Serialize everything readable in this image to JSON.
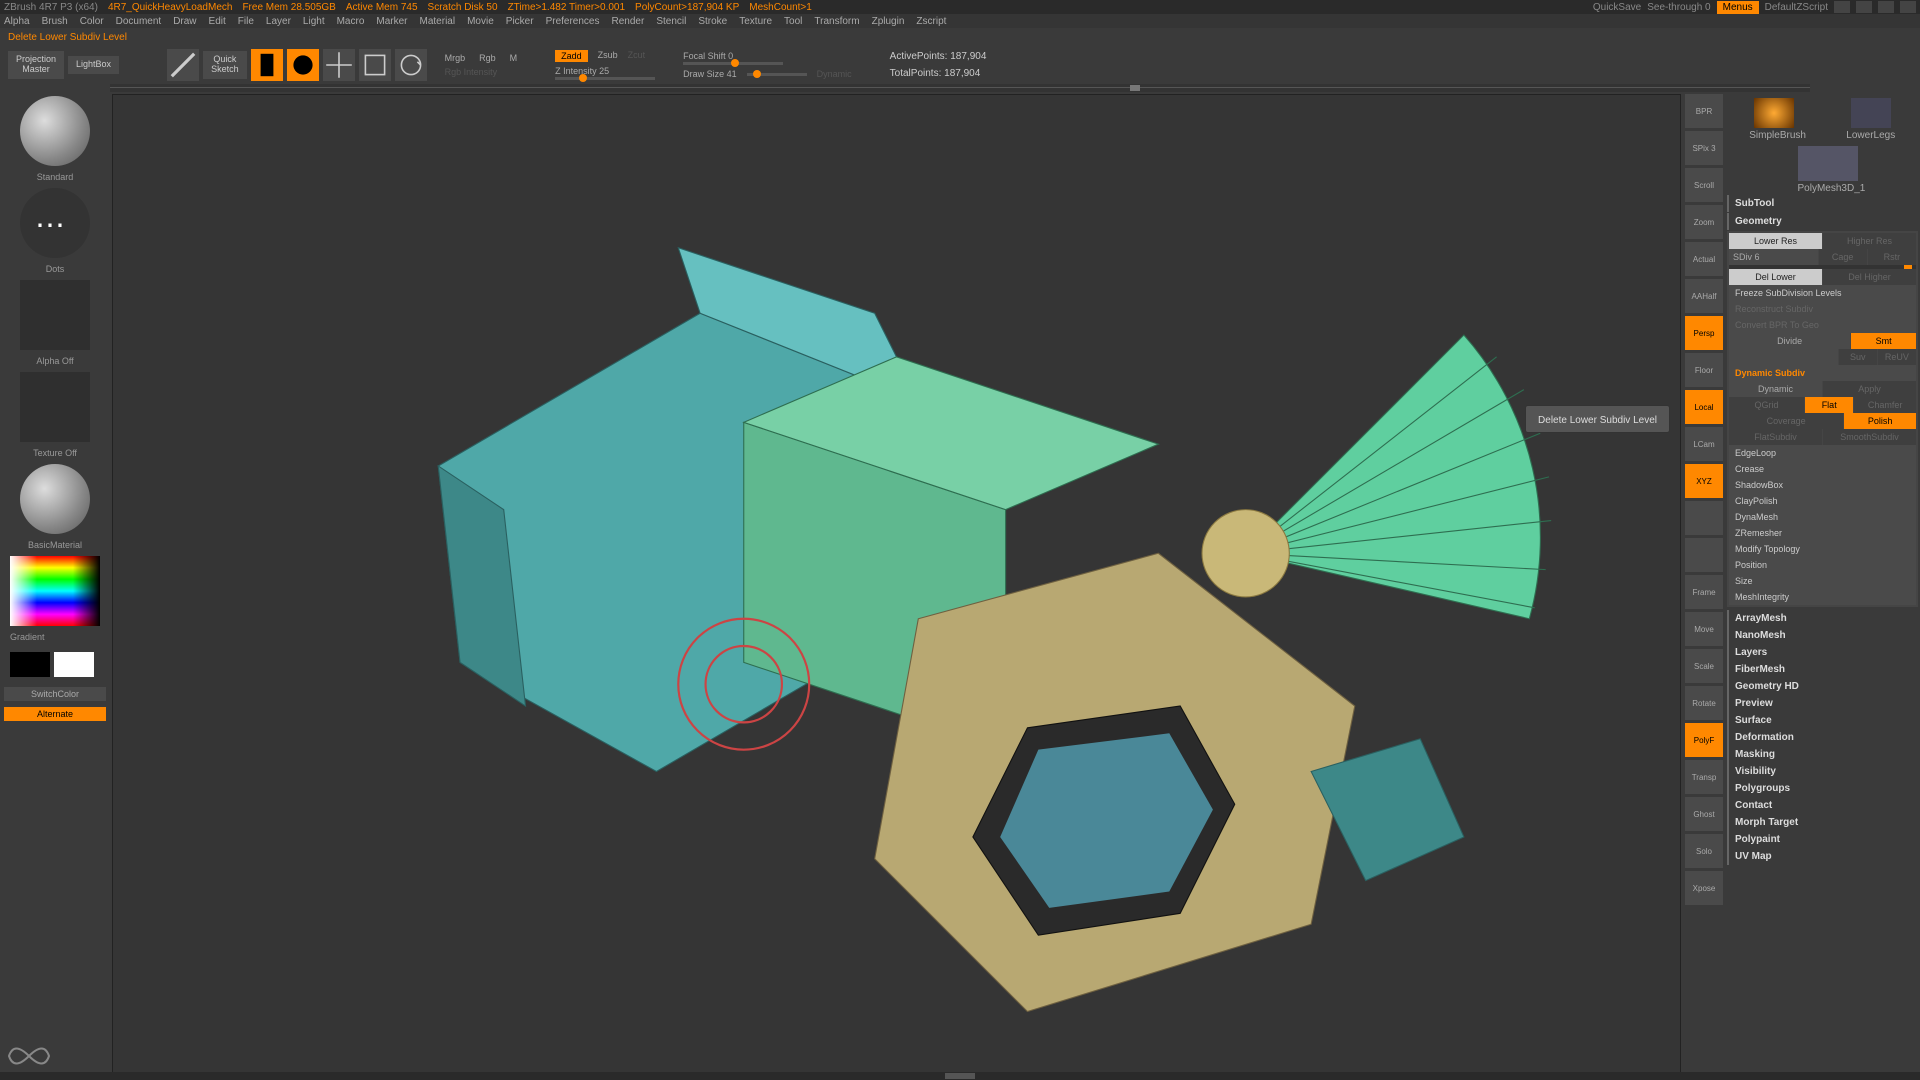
{
  "titlebar": {
    "app": "ZBrush 4R7 P3 (x64)",
    "doc": "4R7_QuickHeavyLoadMech",
    "mem": "Free Mem 28.505GB",
    "active_mem": "Active Mem 745",
    "scratch": "Scratch Disk 50",
    "ztime": "ZTime>1.482  Timer>0.001",
    "polycount": "PolyCount>187,904 KP",
    "meshcount": "MeshCount>1",
    "quicksave": "QuickSave",
    "seethrough": "See-through  0",
    "menus": "Menus",
    "script": "DefaultZScript"
  },
  "menu": [
    "Alpha",
    "Brush",
    "Color",
    "Document",
    "Draw",
    "Edit",
    "File",
    "Layer",
    "Light",
    "Macro",
    "Marker",
    "Material",
    "Movie",
    "Picker",
    "Preferences",
    "Render",
    "Stencil",
    "Stroke",
    "Texture",
    "Tool",
    "Transform",
    "Zplugin",
    "Zscript"
  ],
  "status": "Delete Lower Subdiv Level",
  "toolbar": {
    "projection": "Projection\nMaster",
    "lightbox": "LightBox",
    "quicksketch": "Quick\nSketch",
    "edit": "Edit",
    "draw": "Draw",
    "move": "Move",
    "scale": "Scale",
    "rotate": "Rotate",
    "mrgb": "Mrgb",
    "rgb": "Rgb",
    "m": "M",
    "rgb_intensity": "Rgb Intensity",
    "zadd": "Zadd",
    "zsub": "Zsub",
    "zcut": "Zcut",
    "z_intensity": "Z Intensity 25",
    "focal": "Focal Shift 0",
    "drawsize": "Draw Size 41",
    "dynamic": "Dynamic",
    "activepoints": "ActivePoints:  187,904",
    "totalpoints": "TotalPoints:  187,904"
  },
  "left": {
    "brush": "Standard",
    "stroke": "Dots",
    "alpha": "Alpha Off",
    "texture": "Texture Off",
    "material": "BasicMaterial",
    "gradient": "Gradient",
    "switchcolor": "SwitchColor",
    "alternate": "Alternate"
  },
  "right_thumbs": {
    "a": "SimpleBrush",
    "b": "LowerLegs",
    "c": "PolyMesh3D_1"
  },
  "tooltip": "Delete Lower Subdiv Level",
  "side": [
    {
      "t": "BPR",
      "l": "BPR"
    },
    {
      "t": "",
      "l": "SPix 3"
    },
    {
      "t": "",
      "l": "Scroll"
    },
    {
      "t": "",
      "l": "Zoom"
    },
    {
      "t": "",
      "l": "Actual"
    },
    {
      "t": "",
      "l": "AAHalf"
    },
    {
      "t": "",
      "l": "Persp",
      "orange": true
    },
    {
      "t": "",
      "l": "Floor"
    },
    {
      "t": "",
      "l": "Local",
      "orange": true
    },
    {
      "t": "",
      "l": "LCam"
    },
    {
      "t": "",
      "l": "XYZ",
      "orange": true
    },
    {
      "t": "",
      "l": ""
    },
    {
      "t": "",
      "l": ""
    },
    {
      "t": "",
      "l": "Frame"
    },
    {
      "t": "",
      "l": "Move"
    },
    {
      "t": "",
      "l": "Scale"
    },
    {
      "t": "",
      "l": "Rotate"
    },
    {
      "t": "",
      "l": "PolyF",
      "orange": true
    },
    {
      "t": "",
      "l": "Transp"
    },
    {
      "t": "",
      "l": "Ghost"
    },
    {
      "t": "",
      "l": "Solo"
    },
    {
      "t": "",
      "l": "Xpose"
    }
  ],
  "panel": {
    "subtool": "SubTool",
    "geometry": "Geometry",
    "lower_res": "Lower Res",
    "higher_res": "Higher Res",
    "sdiv": "SDiv 6",
    "cage": "Cage",
    "rstr": "Rstr",
    "del_lower": "Del Lower",
    "del_higher": "Del Higher",
    "freeze": "Freeze SubDivision Levels",
    "reconstruct": "Reconstruct Subdiv",
    "convert_bpr": "Convert BPR To Geo",
    "divide": "Divide",
    "smt": "Smt",
    "suv": "Suv",
    "reuv": "ReUV",
    "dyn_subdiv": "Dynamic Subdiv",
    "dynamic": "Dynamic",
    "apply": "Apply",
    "qgrid": "QGrid",
    "flat": "Flat",
    "chamfer": "Chamfer",
    "coverage": "Coverage",
    "polish": "Polish",
    "flatsubdiv": "FlatSubdiv",
    "smoothsubdiv": "SmoothSubdiv",
    "sections": [
      "EdgeLoop",
      "Crease",
      "ShadowBox",
      "ClayPolish",
      "DynaMesh",
      "ZRemesher",
      "Modify Topology",
      "Position",
      "Size",
      "MeshIntegrity"
    ],
    "bottom_sections": [
      "ArrayMesh",
      "NanoMesh",
      "Layers",
      "FiberMesh",
      "Geometry HD",
      "Preview",
      "Surface",
      "Deformation",
      "Masking",
      "Visibility",
      "Polygroups",
      "Contact",
      "Morph Target",
      "Polypaint",
      "UV Map"
    ]
  }
}
